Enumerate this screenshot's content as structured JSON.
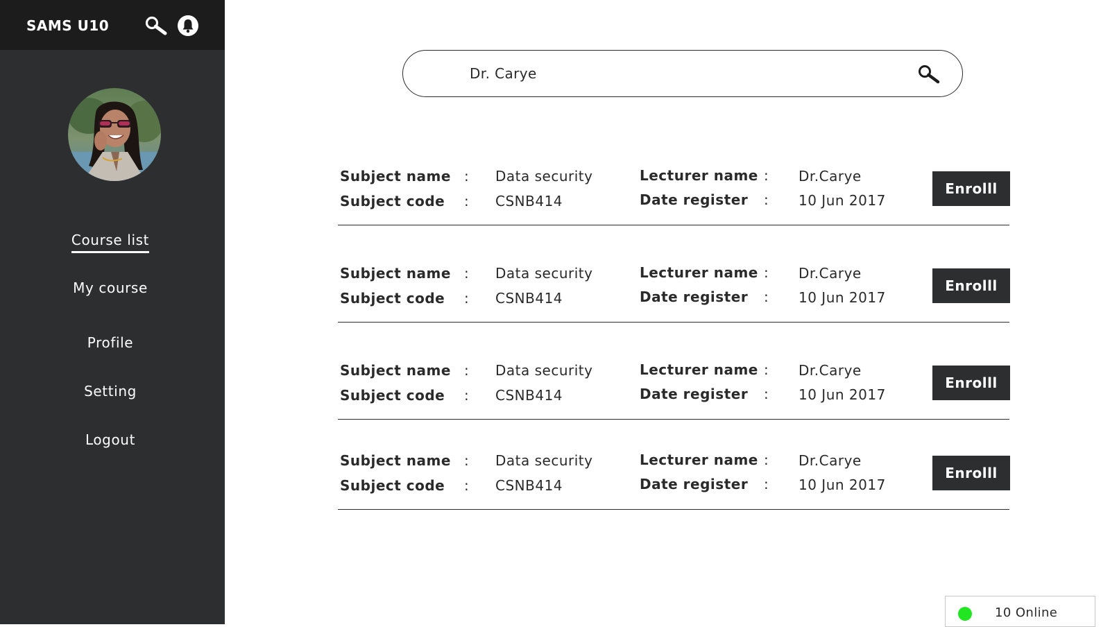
{
  "app": {
    "title": "SAMS U10",
    "status_color": "#22e622",
    "sidebar_color": "#2d2e30"
  },
  "header": {
    "search_icon": "search-icon",
    "notification_icon": "bell-icon"
  },
  "sidebar": {
    "avatar": "user-avatar",
    "items": [
      {
        "label": "Course list",
        "active": true
      },
      {
        "label": "My course",
        "active": false
      },
      {
        "label": "Profile",
        "active": false
      },
      {
        "label": "Setting",
        "active": false
      },
      {
        "label": "Logout",
        "active": false
      }
    ]
  },
  "search": {
    "value": "Dr. Carye",
    "icon": "search-icon"
  },
  "courses": {
    "labels": {
      "subject_name": "Subject name",
      "subject_code": "Subject code",
      "lecturer_name": "Lecturer name",
      "date_register": "Date register",
      "separator": ":",
      "enroll": "Enrolll"
    },
    "rows": [
      {
        "subject_name": "Data security",
        "subject_code": "CSNB414",
        "lecturer_name": "Dr.Carye",
        "date_register": "10 Jun 2017"
      },
      {
        "subject_name": "Data security",
        "subject_code": "CSNB414",
        "lecturer_name": "Dr.Carye",
        "date_register": "10 Jun 2017"
      },
      {
        "subject_name": "Data security",
        "subject_code": "CSNB414",
        "lecturer_name": "Dr.Carye",
        "date_register": "10 Jun 2017"
      },
      {
        "subject_name": "Data security",
        "subject_code": "CSNB414",
        "lecturer_name": "Dr.Carye",
        "date_register": "10 Jun 2017"
      }
    ]
  },
  "status": {
    "online_text": "10 Online"
  }
}
